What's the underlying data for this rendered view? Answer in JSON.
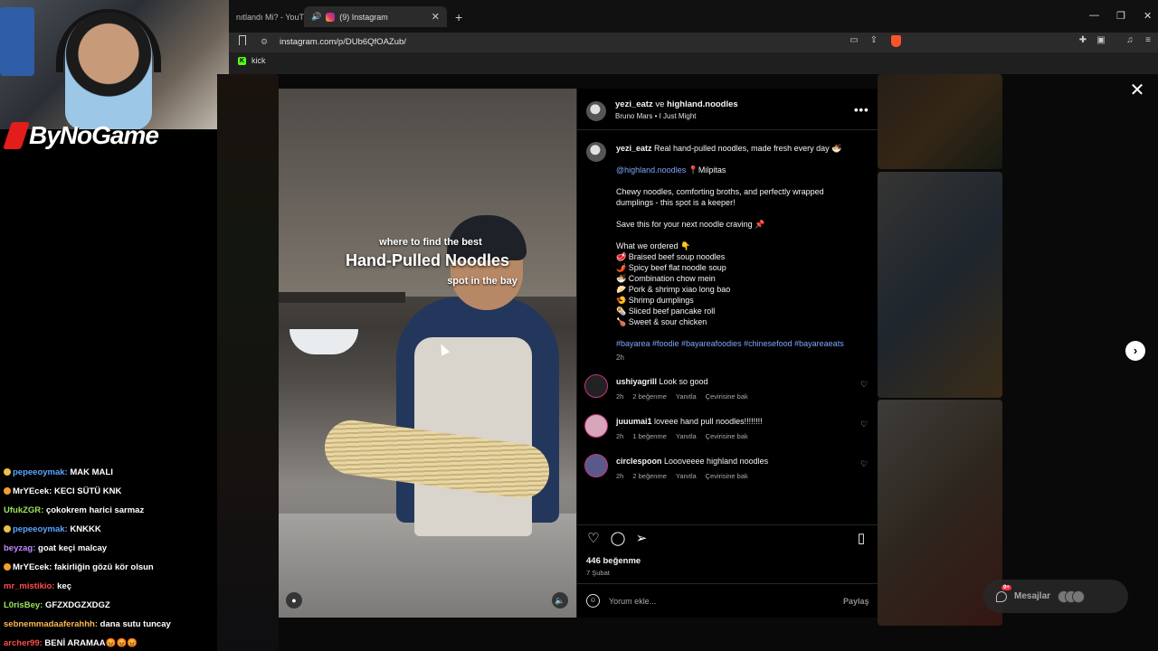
{
  "browser": {
    "tabs": [
      {
        "label": "nıtlandı Mi? - YouTu"
      },
      {
        "label": "(9) Instagram"
      }
    ],
    "url": "instagram.com/p/DUb6QfOAZub/",
    "bookmarks": [
      {
        "label": "kick"
      }
    ]
  },
  "stream": {
    "brand": "ByNoGame",
    "chat": [
      {
        "user": "pepeeoymak:",
        "msg": " MAK MALI",
        "color": "#58a6ff",
        "badge": "#e8c14a"
      },
      {
        "user": "MrYEcek:",
        "msg": " KECI SÜTÜ KNK",
        "color": "#ffffff",
        "badge": "#f0a030"
      },
      {
        "user": "UfukZGR:",
        "msg": " çokokrem harici sarmaz",
        "color": "#9be55a",
        "badge": ""
      },
      {
        "user": "pepeeoymak:",
        "msg": " KNKKK",
        "color": "#58a6ff",
        "badge": "#e8c14a"
      },
      {
        "user": "beyzag:",
        "msg": " goat keçi malcay",
        "color": "#c18aff",
        "badge": ""
      },
      {
        "user": "MrYEcek:",
        "msg": " fakirliğin gözü kör olsun",
        "color": "#ffffff",
        "badge": "#f0a030"
      },
      {
        "user": "mr_mistikio:",
        "msg": " keç",
        "color": "#ff4d4d",
        "badge": ""
      },
      {
        "user": "L0risBey:",
        "msg": " GFZXDGZXDGZ",
        "color": "#9be55a",
        "badge": ""
      },
      {
        "user": "sebnemmadaaferahhh:",
        "msg": " dana sutu tuncay",
        "color": "#ffb84d",
        "badge": ""
      },
      {
        "user": "archer99:",
        "msg": " BENİ ARAMAA😡😡😡",
        "color": "#ff4d4d",
        "badge": ""
      }
    ]
  },
  "video": {
    "caption_top": "where to find the best",
    "caption_main": "Hand-Pulled Noodles",
    "caption_bottom": "spot in the bay"
  },
  "post": {
    "user1": "yezi_eatz",
    "and": " ve ",
    "user2": "highland.noodles",
    "song": "Bruno Mars • I Just Might",
    "caption": {
      "user": "yezi_eatz",
      "line1": " Real hand-pulled noodles, made fresh every day 🍜",
      "mention": "@highland.noodles",
      "location": " 📍Milpitas",
      "p1a": "Chewy noodles, comforting broths, and perfectly wrapped",
      "p1b": "dumplings - this spot is a keeper!",
      "p2": "Save this for your next noodle craving 📌",
      "ordered": "What we ordered 👇",
      "items": [
        "🥩 Braised beef soup noodles",
        "🌶️ Spicy beef flat noodle soup",
        "🍜 Combination chow mein",
        "🥟 Pork & shrimp xiao long bao",
        "🍤 Shrimp dumplings",
        "🌯 Sliced beef pancake roll",
        "🍗 Sweet & sour chicken"
      ],
      "hashtags": "#bayarea #foodie #bayareafoodies #chinesefood #bayareaeats",
      "time": "2h"
    },
    "comments": [
      {
        "user": "ushiyagrill",
        "text": " Look so good",
        "time": "2h",
        "likes": "2 beğenme",
        "reply": "Yanıtla",
        "translate": "Çevirisine bak"
      },
      {
        "user": "juuumai1",
        "text": " loveee hand pull noodles!!!!!!!!",
        "time": "2h",
        "likes": "1 beğenme",
        "reply": "Yanıtla",
        "translate": "Çevirisine bak"
      },
      {
        "user": "circlespoon",
        "text": " Loooveeee highland noodles",
        "time": "2h",
        "likes": "2 beğenme",
        "reply": "Yanıtla",
        "translate": "Çevirisine bak"
      }
    ],
    "likes": "446 beğenme",
    "date": "7 Şubat",
    "comment_placeholder": "Yorum ekle...",
    "share_label": "Paylaş"
  },
  "messages": {
    "label": "Mesajlar",
    "badge": "9+"
  }
}
